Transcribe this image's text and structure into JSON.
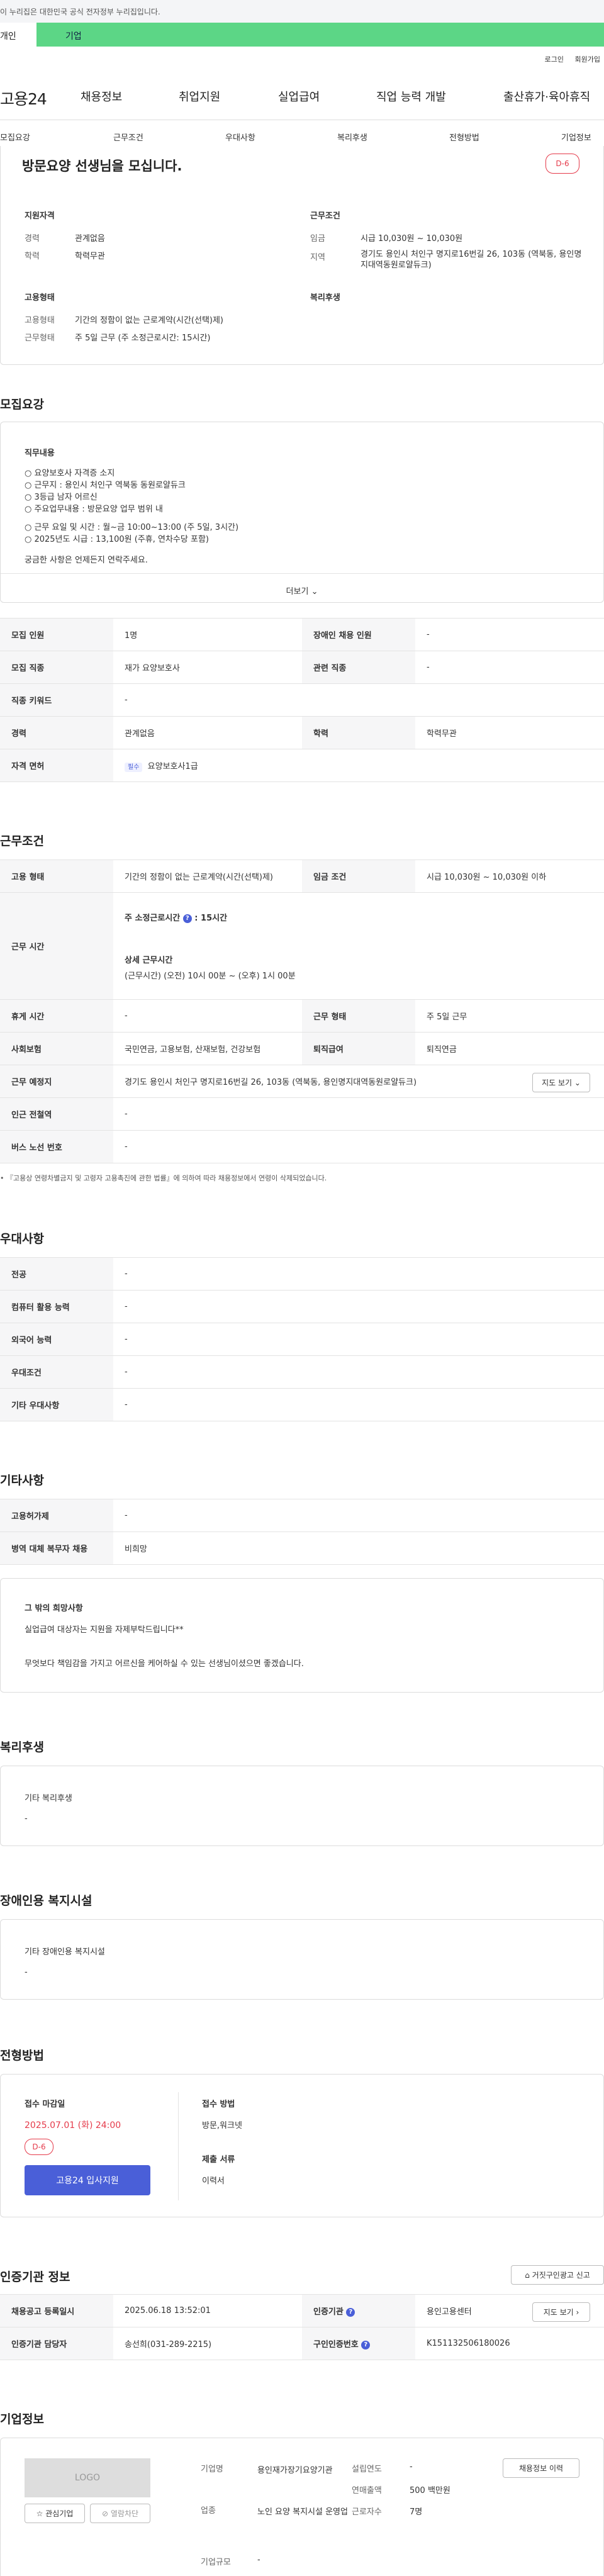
{
  "gov_banner": "이 누리집은 대한민국 공식 전자정부 누리집입니다.",
  "user_tabs": {
    "personal": "개인",
    "company": "기업"
  },
  "util_links": {
    "login": "로그인",
    "join": "회원가입"
  },
  "logo": "고용24",
  "gnb": [
    "채용정보",
    "취업지원",
    "실업급여",
    "직업 능력 개발",
    "출산휴가·육아휴직"
  ],
  "subnav": [
    "모집요강",
    "근무조건",
    "우대사항",
    "복리후생",
    "전형방법",
    "기업정보"
  ],
  "summary": {
    "title": "방문요양 선생님을 모십니다.",
    "dday": "D-6",
    "qual_title": "지원자격",
    "qual_rows": [
      {
        "k": "경력",
        "v": "관계없음"
      },
      {
        "k": "학력",
        "v": "학력무관"
      }
    ],
    "cond_title": "근무조건",
    "cond_rows": [
      {
        "k": "임금",
        "v": "시급 10,030원 ~ 10,030원"
      },
      {
        "k": "지역",
        "v": "경기도 용인시 처인구 명지로16번길 26, 103동 (역북동, 용인명지대역동원로얄듀크)"
      }
    ],
    "emp_title": "고용형태",
    "emp_rows": [
      {
        "k": "고용형태",
        "v": "기간의 정함이 없는 근로계약(시간(선택)제)"
      },
      {
        "k": "근무형태",
        "v": "주 5일 근무 (주 소정근로시간: 15시간)"
      }
    ],
    "welfare_title": "복리후생"
  },
  "recruit": {
    "heading": "모집요강",
    "duty_title": "직무내용",
    "duty_lines": [
      "○ 요양보호사 자격증 소지",
      "○ 근무지 : 용인시 처인구 역북동 동원로얄듀크",
      "○ 3등급 남자 어르신",
      "○ 주요업무내용 : 방문요양 업무 범위 내",
      "",
      "○ 근무 요일 및 시간 : 월~금 10:00~13:00 (주 5일, 3시간)",
      "○ 2025년도 시급 : 13,100원 (주휴, 연차수당 포함)",
      "",
      "궁금한 사항은 언제든지 연락주세요."
    ],
    "more_label": "더보기",
    "rows": [
      {
        "k1": "모집 인원",
        "v1": "1명",
        "k2": "장애인 채용 인원",
        "v2": "-"
      },
      {
        "k1": "모집 직종",
        "v1": "재가 요양보호사",
        "k2": "관련 직종",
        "v2": "-"
      },
      {
        "k1": "직종 키워드",
        "v1": "-"
      },
      {
        "k1": "경력",
        "v1": "관계없음",
        "k2": "학력",
        "v2": "학력무관"
      },
      {
        "k1": "자격 면허",
        "badge": "필수",
        "v1": "요양보호사1급"
      }
    ]
  },
  "work": {
    "heading": "근무조건",
    "emp_type_k": "고용 형태",
    "emp_type_v": "기간의 정함이 없는 근로계약(시간(선택)제)",
    "wage_k": "임금 조건",
    "wage_v": "시급 10,030원 ~ 10,030원 이하",
    "time_k": "근무 시간",
    "weekly_label": "주 소정근로시간",
    "weekly_value": "15시간",
    "detail_title": "상세 근무시간",
    "detail_value": "(근무시간) (오전) 10시 00분 ~ (오후) 1시 00분",
    "rest_k": "휴게 시간",
    "rest_v": "-",
    "shape_k": "근무 형태",
    "shape_v": "주 5일 근무",
    "ins_k": "사회보험",
    "ins_v": "국민연금, 고용보험, 산재보험, 건강보험",
    "ret_k": "퇴직급여",
    "ret_v": "퇴직연금",
    "place_k": "근무 예정지",
    "place_v": "경기도 용인시 처인구 명지로16번길 26, 103동 (역북동, 용인명지대역동원로얄듀크)",
    "map_btn": "지도 보기",
    "sub_k": "인근 전철역",
    "sub_v": "-",
    "bus_k": "버스 노선 번호",
    "bus_v": "-",
    "note": "『고용상 연령차별금지 및 고령자 고용촉진에 관한 법률』에 의하여 따라 채용정보에서 연령이 삭제되었습니다."
  },
  "prefer": {
    "heading": "우대사항",
    "rows": [
      {
        "k": "전공",
        "v": "-"
      },
      {
        "k": "컴퓨터 활용 능력",
        "v": "-"
      },
      {
        "k": "외국어 능력",
        "v": "-"
      },
      {
        "k": "우대조건",
        "v": "-"
      },
      {
        "k": "기타 우대사항",
        "v": "-"
      }
    ]
  },
  "etc": {
    "heading": "기타사항",
    "rows": [
      {
        "k": "고용허가제",
        "v": "-"
      },
      {
        "k": "병역 대체 복무자 채용",
        "v": "비희망"
      }
    ],
    "box_title": "그 밖의 희망사항",
    "box_lines": [
      "실업급여 대상자는 지원을 자제부탁드립니다**",
      "",
      "무엇보다 책임감을 가지고 어르신을 케어하실 수 있는 선생님이셨으면 좋겠습니다."
    ]
  },
  "welfare": {
    "heading": "복리후생",
    "title": "기타 복리후생",
    "value": "-"
  },
  "disabled": {
    "heading": "장애인용 복지시설",
    "title": "기타 장애인용 복지시설",
    "value": "-"
  },
  "process": {
    "heading": "전형방법",
    "deadline_title": "접수 마감일",
    "deadline": "2025.07.01 (화) 24:00",
    "dday": "D-6",
    "apply_btn": "고용24 입사지원",
    "method_title": "접수 방법",
    "method_value": "방문,워크넷",
    "docs_title": "제출 서류",
    "docs_value": "이력서"
  },
  "agency": {
    "heading": "인증기관 정보",
    "report_btn": "거짓구인광고 신고",
    "reg_k": "채용공고 등록일시",
    "reg_v": "2025.06.18 13:52:01",
    "auth_k": "인증기관",
    "auth_v": "용인고용센터",
    "map_btn": "지도 보기",
    "mgr_k": "인증기관 담당자",
    "mgr_v": "송선희(031-289-2215)",
    "num_k": "구인인증번호",
    "num_v": "K151132506180026"
  },
  "company": {
    "heading": "기업정보",
    "logo_text": "LOGO",
    "fav_btn": "관심기업",
    "block_btn": "열람차단",
    "name_k": "기업명",
    "name_v": "용인재가장기요양기관",
    "biz_k": "업종",
    "biz_v": "노인 요양 복지시설 운영업",
    "size_k": "기업규모",
    "size_v": "-",
    "est_k": "설립연도",
    "est_v": "-",
    "sales_k": "연매출액",
    "sales_v": "500 백만원",
    "emp_k": "근로자수",
    "emp_v": "7명",
    "history_btn": "채용정보 이력"
  }
}
